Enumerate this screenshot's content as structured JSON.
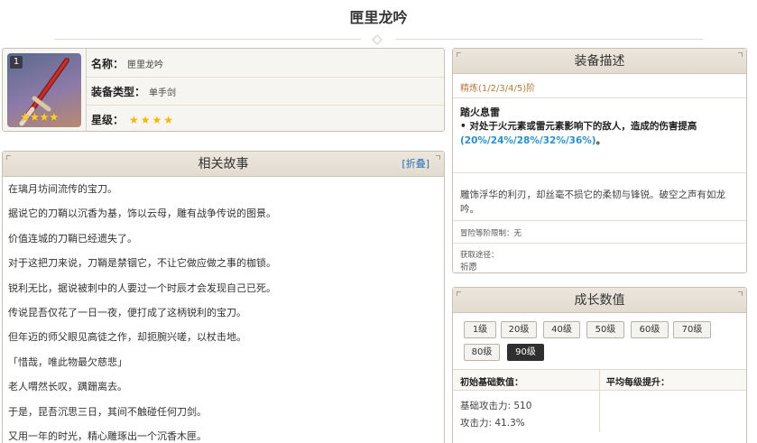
{
  "page": {
    "title": "匣里龙吟"
  },
  "info": {
    "refine_badge": "1",
    "name_label": "名称：",
    "name_value": "匣里龙吟",
    "type_label": "装备类型：",
    "type_value": "单手剑",
    "rarity_label": "星级：",
    "rarity_stars": "★★★★",
    "image_stars": "★★★★",
    "rarity_value": 4
  },
  "story": {
    "title": "相关故事",
    "fold_label": "[折叠]",
    "lines": [
      "在璃月坊间流传的宝刀。",
      "据说它的刀鞘以沉香为基，饰以云母，雕有战争传说的图景。",
      "价值连城的刀鞘已经遗失了。",
      "对于这把刀来说，刀鞘是禁锢它，不让它做应做之事的枷锁。",
      "锐利无比，据说被刺中的人要过一个时辰才会发现自己已死。",
      "传说昆吾仅花了一日一夜，便打成了这柄锐利的宝刀。",
      "但年迈的师父眼见高徒之作，却扼腕兴嗟，以杖击地。",
      "「惜哉，唯此物最欠慈悲」",
      "老人喟然长叹，蹒跚离去。",
      "于是，昆吾沉思三日，其间不触碰任何刀剑。",
      "又用一年的时光，精心雕琢出一个沉香木匣。"
    ]
  },
  "equip": {
    "title": "装备描述",
    "refine_text": "精炼(1/2/3/4/5)阶",
    "skill_name": "踏火息雷",
    "skill_desc_prefix": "• 对处于火元素或雷元素影响下的敌人，造成的伤害提高",
    "skill_desc_values": "(20%/24%/28%/32%/36%)",
    "skill_desc_suffix": "。",
    "flavor": "雕饰浮华的利刃，却丝毫不损它的柔韧与锋锐。破空之声有如龙吟。",
    "ascend_limit": "冒险等阶限制：无",
    "source_label": "获取途径：",
    "source_value": "祈愿"
  },
  "growth": {
    "title": "成长数值",
    "levels": [
      "1级",
      "20级",
      "40级",
      "50级",
      "60级",
      "70级",
      "80级",
      "90级"
    ],
    "active_level": "90级",
    "col_base": "初始基础数值：",
    "col_avg": "平均每级提升：",
    "base_atk": "基础攻击力: 510",
    "atk_pct": "攻击力: 41.3%"
  }
}
